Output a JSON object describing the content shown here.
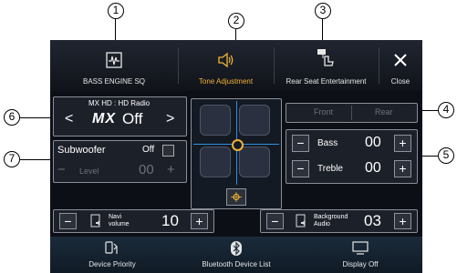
{
  "callouts": {
    "c1": "1",
    "c2": "2",
    "c3": "3",
    "c4": "4",
    "c5": "5",
    "c6": "6",
    "c7": "7"
  },
  "tabs": [
    {
      "label": "BASS ENGINE SQ",
      "icon": "waveform-icon"
    },
    {
      "label": "Tone Adjustment",
      "icon": "speaker-icon"
    },
    {
      "label": "Rear Seat Entertainment",
      "icon": "rear-seat-icon"
    },
    {
      "label": "Close",
      "icon": "close-icon"
    }
  ],
  "radio": {
    "title": "MX HD : HD Radio",
    "logo": "MX",
    "value": "Off",
    "prev": "<",
    "next": ">"
  },
  "subwoofer": {
    "label": "Subwoofer",
    "toggle": "Off",
    "level_label": "Level",
    "level_value": "00",
    "minus": "−",
    "plus": "+"
  },
  "front_rear": {
    "front": "Front",
    "rear": "Rear"
  },
  "bass": {
    "label": "Bass",
    "value": "00",
    "minus": "−",
    "plus": "+"
  },
  "treble": {
    "label": "Treble",
    "value": "00",
    "minus": "−",
    "plus": "+"
  },
  "navi": {
    "label": "Navi volume",
    "value": "10",
    "minus": "−",
    "plus": "+"
  },
  "background": {
    "label": "Background Audio",
    "value": "03",
    "minus": "−",
    "plus": "+"
  },
  "bottom": [
    {
      "label": "Device Priority",
      "icon": "device-priority-icon"
    },
    {
      "label": "Bluetooth Device List",
      "icon": "bluetooth-icon"
    },
    {
      "label": "Display Off",
      "icon": "display-icon"
    }
  ],
  "colors": {
    "accent": "#f2b233",
    "fader_line": "#2f8fe0"
  }
}
